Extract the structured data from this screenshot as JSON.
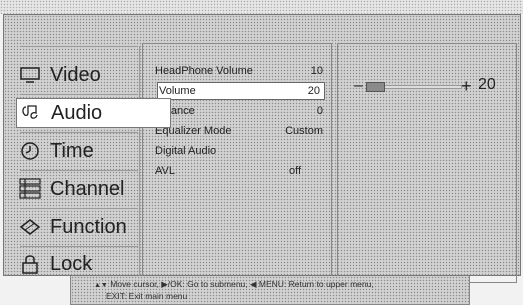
{
  "menu": {
    "items": [
      {
        "label": "Video",
        "icon": "monitor-icon"
      },
      {
        "label": "Audio",
        "icon": "music-note-icon"
      },
      {
        "label": "Time",
        "icon": "clock-icon"
      },
      {
        "label": "Channel",
        "icon": "channel-list-icon"
      },
      {
        "label": "Function",
        "icon": "diamond-icon"
      },
      {
        "label": "Lock",
        "icon": "lock-icon"
      }
    ],
    "active": "Audio"
  },
  "audio": {
    "rows": [
      {
        "label": "HeadPhone Volume",
        "value": "10"
      },
      {
        "label": "Volume",
        "value": "20"
      },
      {
        "label": "Balance",
        "value": "0"
      },
      {
        "label": "Equalizer Mode",
        "value": "Custom"
      },
      {
        "label": "Digital Audio",
        "value": ""
      },
      {
        "label": "AVL",
        "value": "off"
      }
    ],
    "selected": "Volume"
  },
  "slider": {
    "minus": "–",
    "plus": "+",
    "value": "20",
    "fraction": 0.2
  },
  "hint": {
    "line1": "Move cursor, ▶/OK: Go to submenu, ◀ MENU: Return to upper menu,",
    "line2": "EXIT: Exit main menu"
  }
}
